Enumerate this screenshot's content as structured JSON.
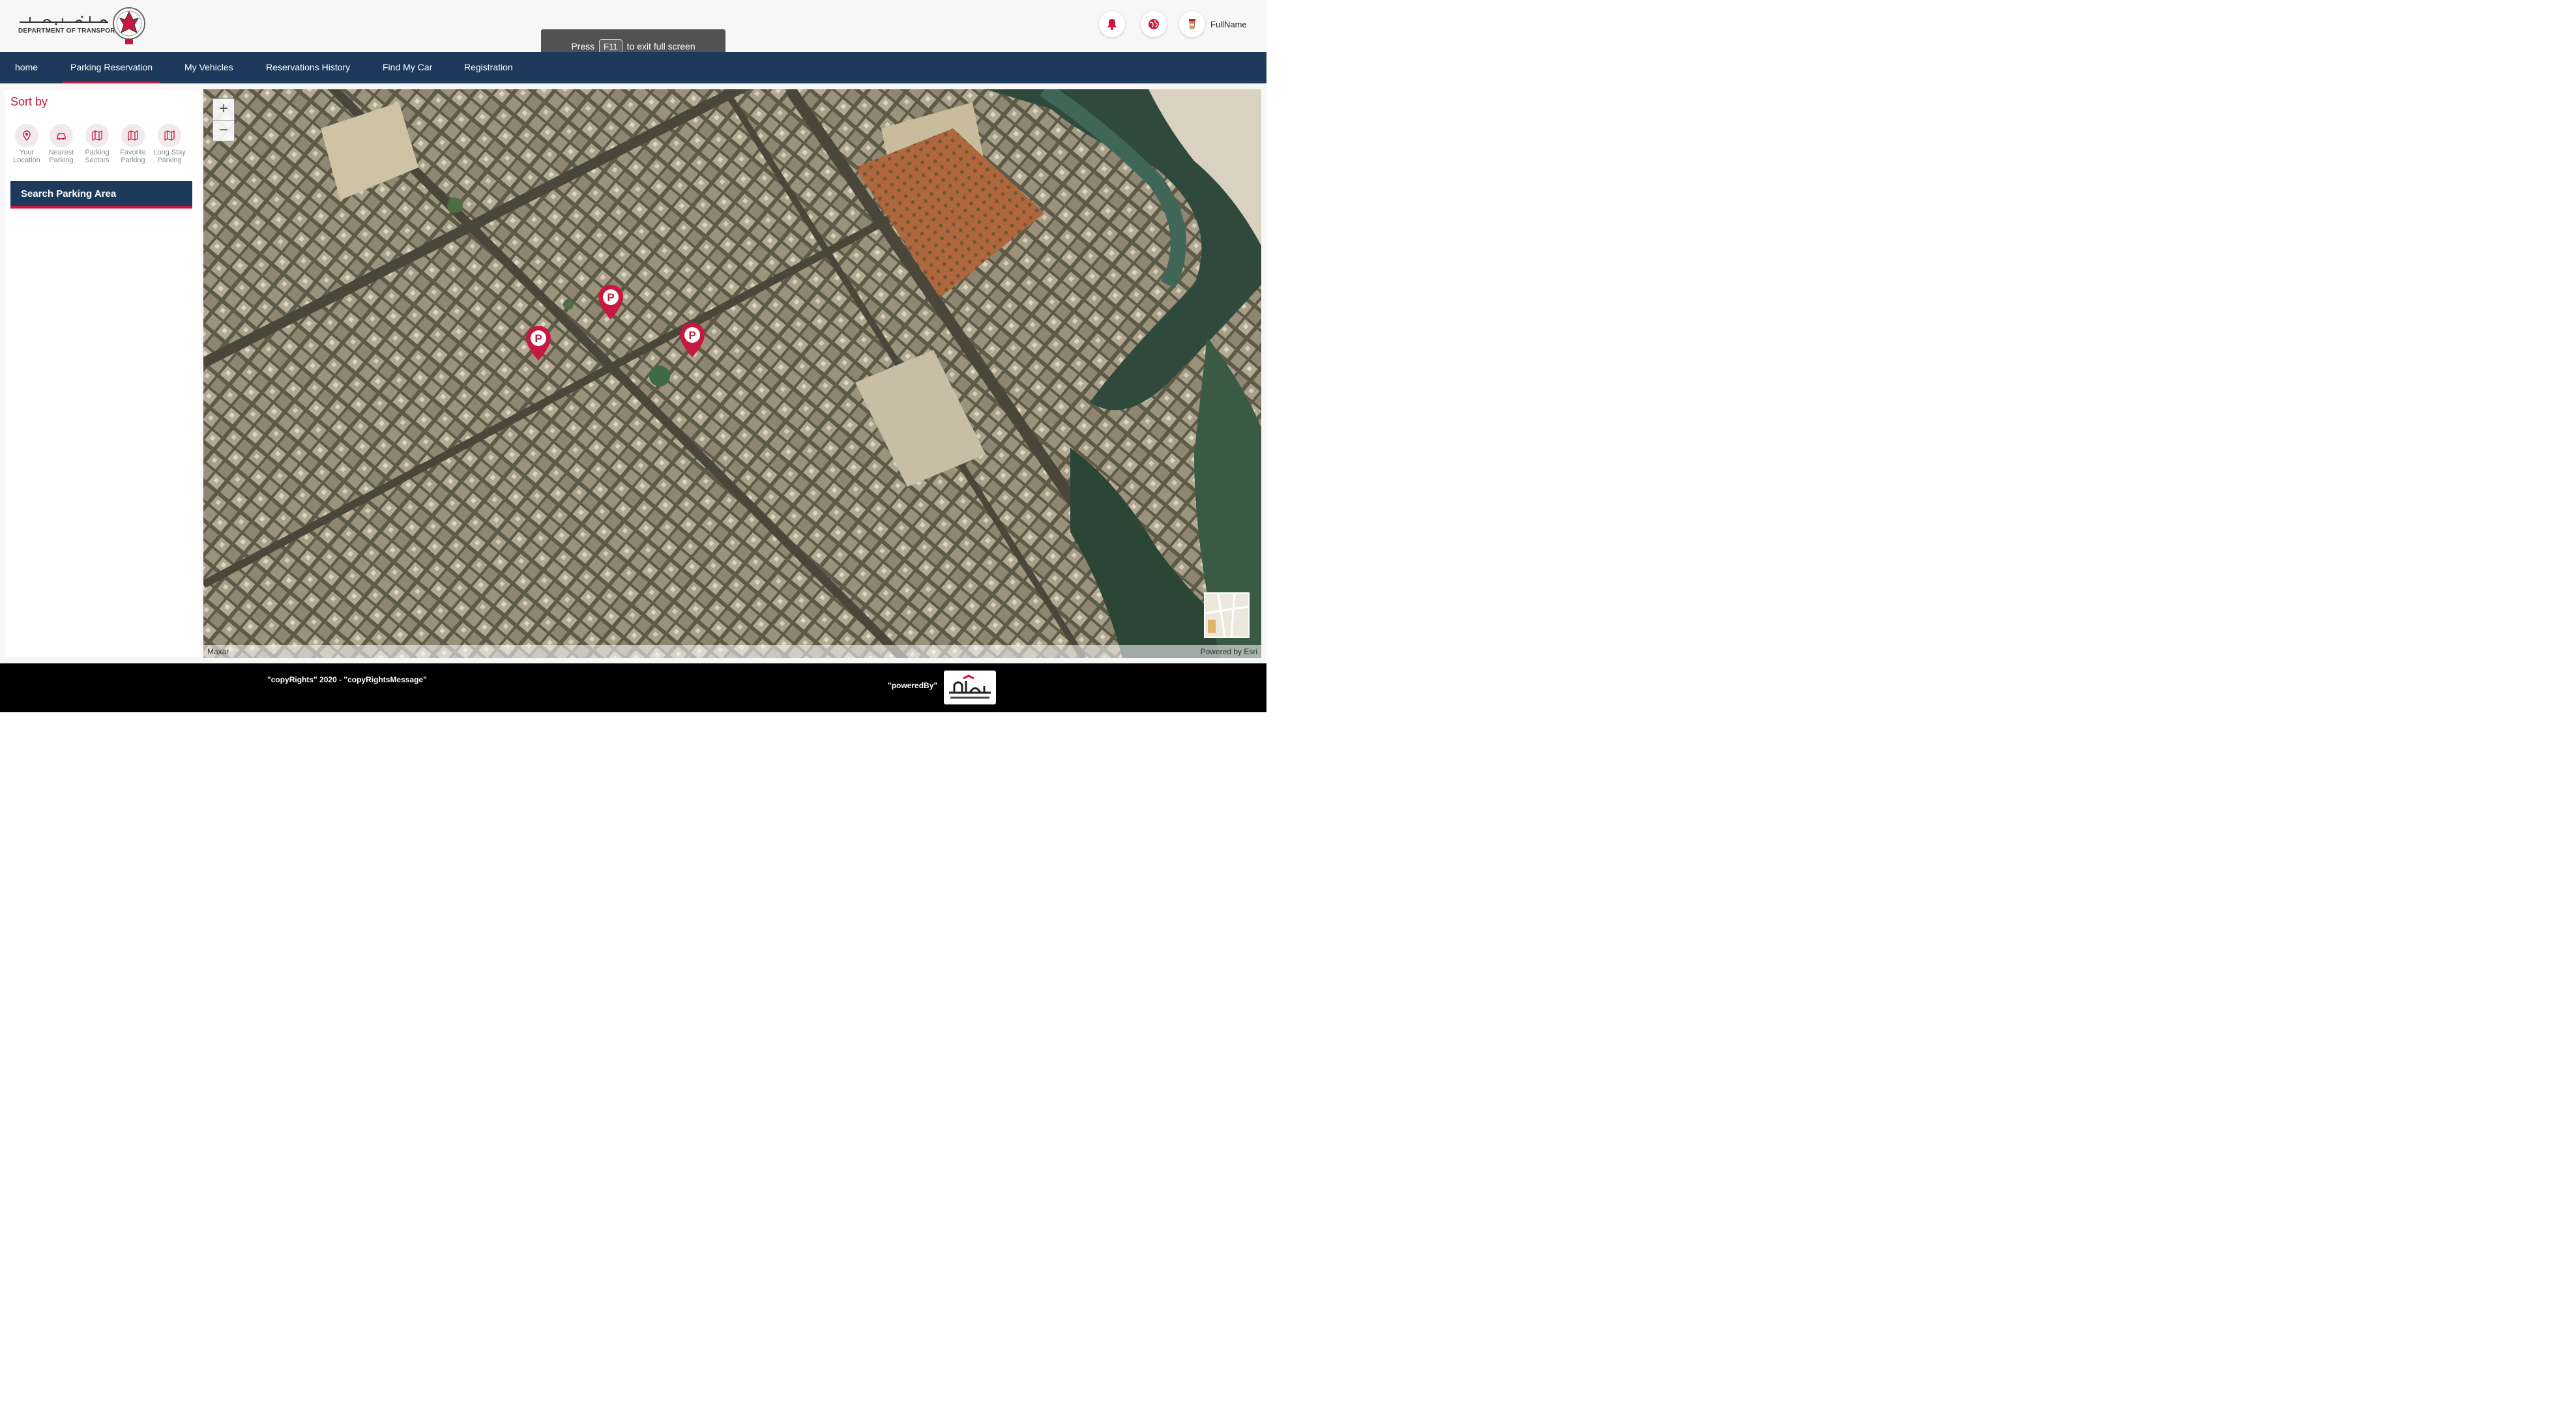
{
  "header": {
    "logo_en": "DEPARTMENT OF TRANSPORT",
    "logo_ar": "دائرة النقل",
    "user_name": "FullName"
  },
  "toast": {
    "press": "Press",
    "key": "F11",
    "suffix": "to exit full screen"
  },
  "nav": {
    "items": [
      {
        "label": "home"
      },
      {
        "label": "Parking Reservation"
      },
      {
        "label": "My Vehicles"
      },
      {
        "label": "Reservations History"
      },
      {
        "label": "Find My Car"
      },
      {
        "label": "Registration"
      }
    ]
  },
  "sidebar": {
    "sort_title": "Sort by",
    "sort_options": [
      {
        "line1": "Your",
        "line2": "Location",
        "icon": "location-icon"
      },
      {
        "line1": "Nearest",
        "line2": "Parking",
        "icon": "car-icon"
      },
      {
        "line1": "Parking",
        "line2": "Sectors",
        "icon": "map-icon"
      },
      {
        "line1": "Favorite",
        "line2": "Parking",
        "icon": "map-icon"
      },
      {
        "line1": "Long Stay",
        "line2": "Parking",
        "icon": "map-icon"
      }
    ],
    "search_label": "Search Parking Area"
  },
  "map": {
    "zoom_in": "+",
    "zoom_out": "−",
    "marker_letter": "P",
    "attribution_left": "Maxar",
    "attribution_right": "Powered by Esri"
  },
  "footer": {
    "copyright": "\"copyRights\" 2020 - \"copyRightsMessage\"",
    "powered_by": "\"poweredBy\""
  },
  "colors": {
    "nav_bg": "#1d3a5c",
    "accent": "#c7183f",
    "footer_bg": "#000000"
  }
}
